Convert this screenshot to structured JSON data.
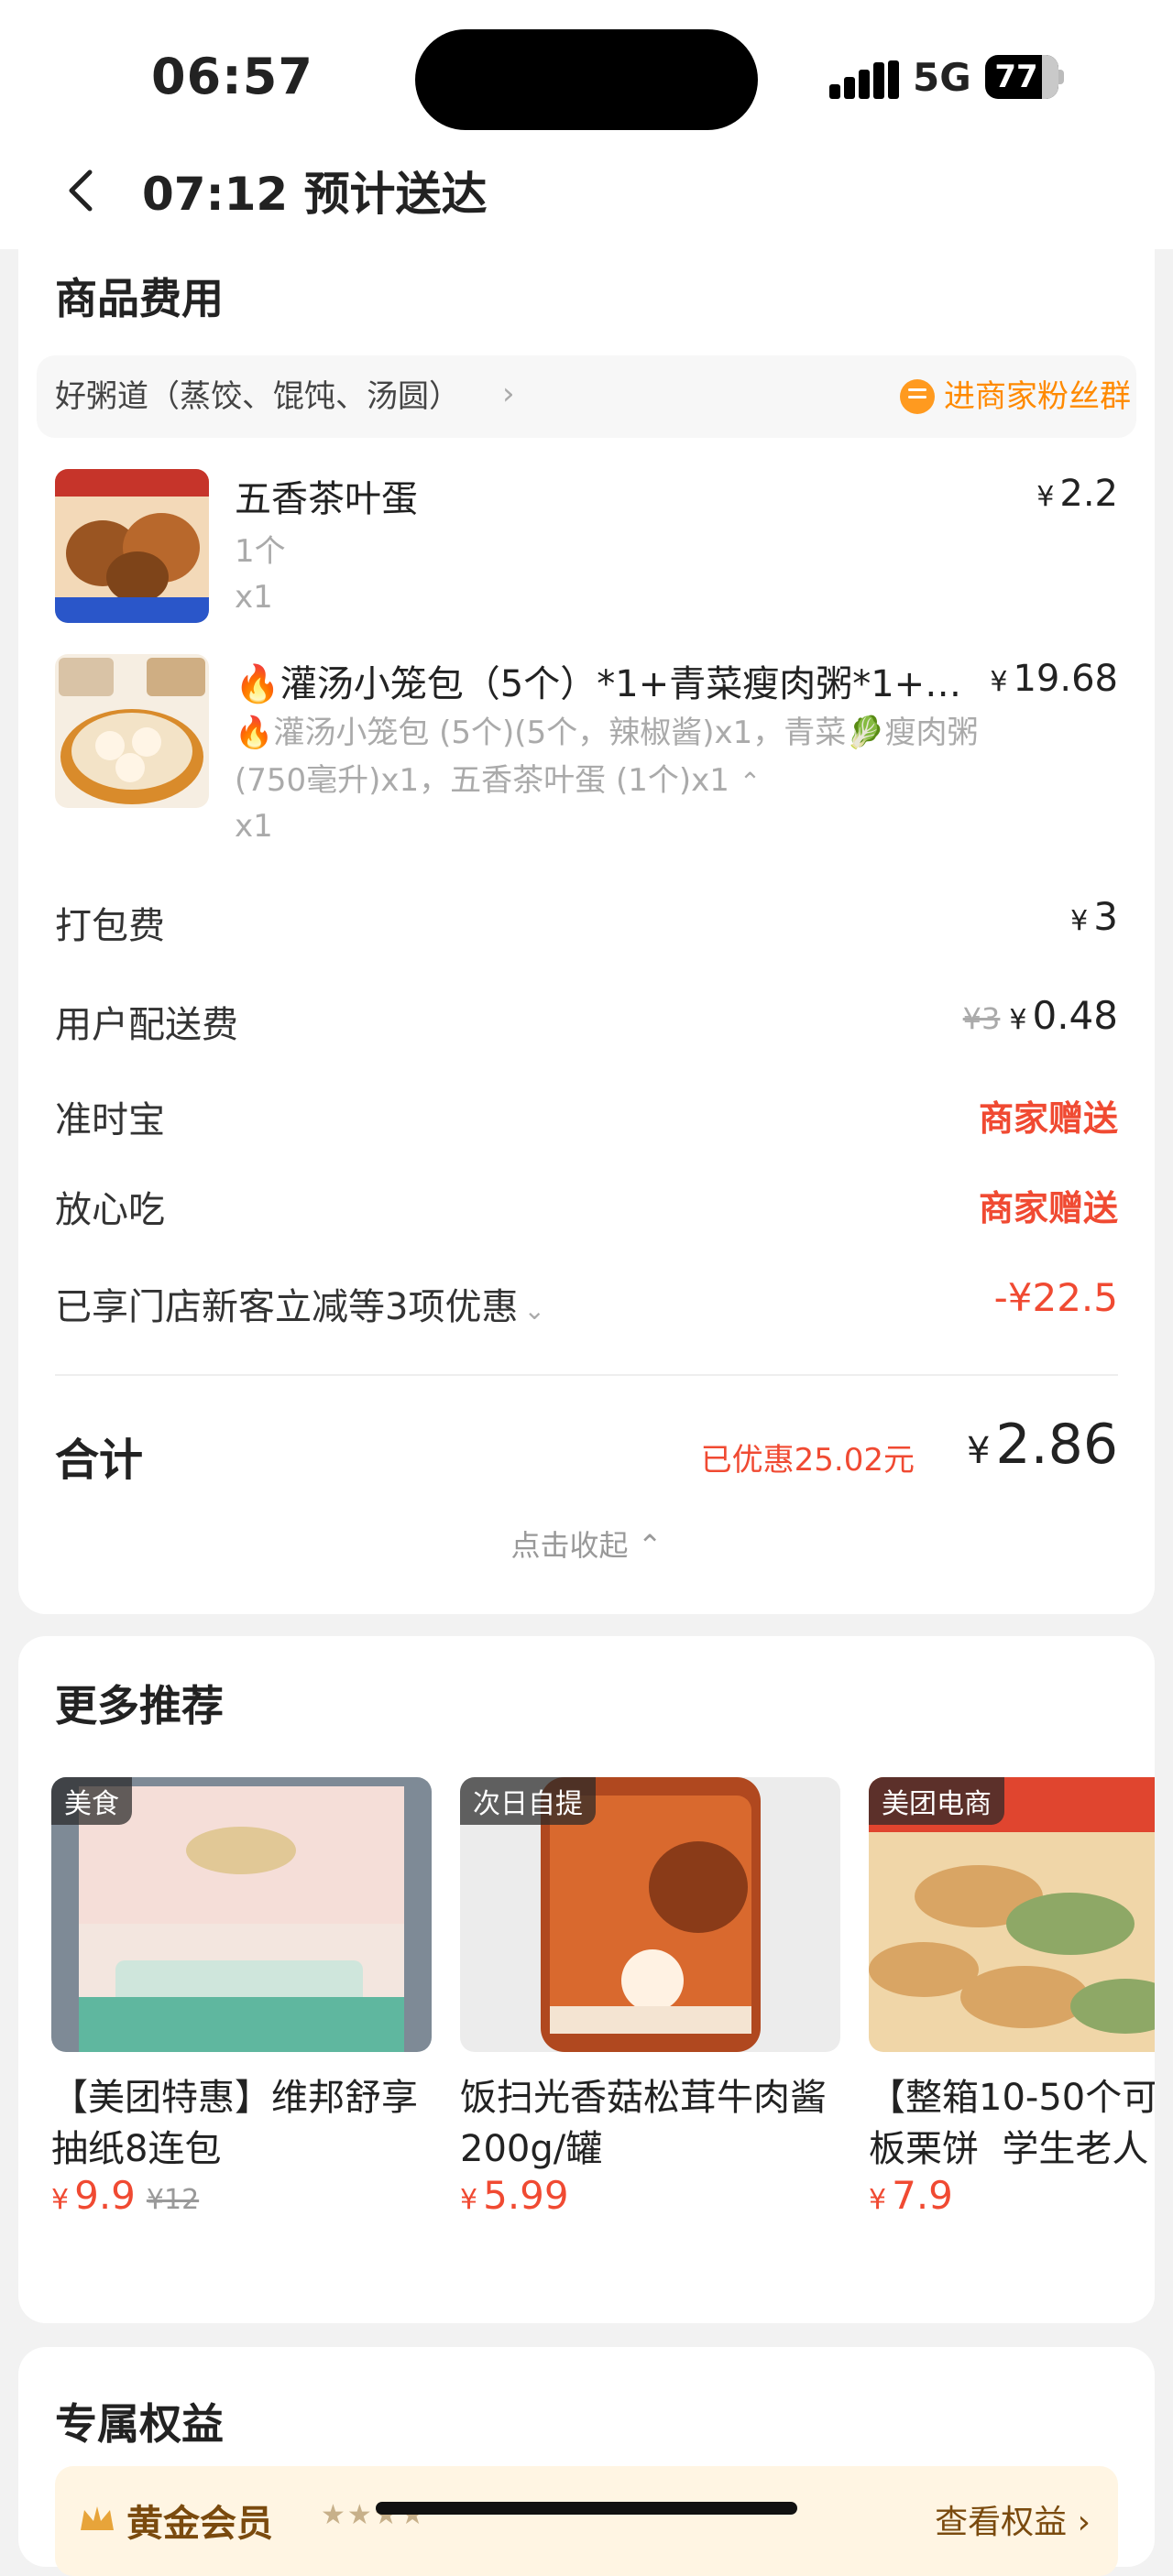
{
  "status": {
    "time": "06:57",
    "network": "5G",
    "battery": "77",
    "battery_level": 0.77
  },
  "header": {
    "title": "07:12 预计送达"
  },
  "fees_section": {
    "title": "商品费用",
    "store": {
      "name": "好粥道（蒸饺、馄饨、汤圆）",
      "fan_group": "进商家粉丝群"
    },
    "items": [
      {
        "name": "五香茶叶蛋",
        "spec": "1个",
        "qty": "x1",
        "price": "2.2"
      },
      {
        "name": "🔥灌汤小笼包（5个）*1+青菜瘦肉粥*1+…",
        "spec_line1": "🔥灌汤小笼包 (5个)(5个，辣椒酱)x1，青菜🥬瘦肉粥",
        "spec_line2": "(750毫升)x1，五香茶叶蛋 (1个)x1",
        "qty": "x1",
        "price": "19.68"
      }
    ],
    "packaging": {
      "label": "打包费",
      "value": "3"
    },
    "delivery": {
      "label": "用户配送费",
      "original": "¥3",
      "value": "0.48"
    },
    "ontime": {
      "label": "准时宝",
      "value": "商家赠送"
    },
    "safe": {
      "label": "放心吃",
      "value": "商家赠送"
    },
    "discount": {
      "label": "已享门店新客立减等3项优惠",
      "value": "-¥22.5"
    },
    "total": {
      "label": "合计",
      "saved": "已优惠25.02元",
      "value": "2.86"
    },
    "collapse": "点击收起"
  },
  "recommend": {
    "title": "更多推荐",
    "products": [
      {
        "tag": "美食",
        "title": "【美团特惠】维邦舒享\n抽纸8连包",
        "price": "9.9",
        "original": "¥12"
      },
      {
        "tag": "次日自提",
        "title": "饭扫光香菇松茸牛肉酱\n200g/罐",
        "price": "5.99",
        "original": ""
      },
      {
        "tag": "美团电商",
        "title": "【整箱10-50个可\n板栗饼  学生老人",
        "price": "7.9",
        "original": ""
      }
    ]
  },
  "benefits": {
    "title": "专属权益",
    "vip": {
      "label": "黄金会员",
      "stars": "★★★★",
      "link": "查看权益 ›"
    }
  },
  "currency": "¥",
  "colors": {
    "accent_red": "#f04a32",
    "accent_orange": "#ff8a00",
    "gold": "#7a4a0e"
  }
}
